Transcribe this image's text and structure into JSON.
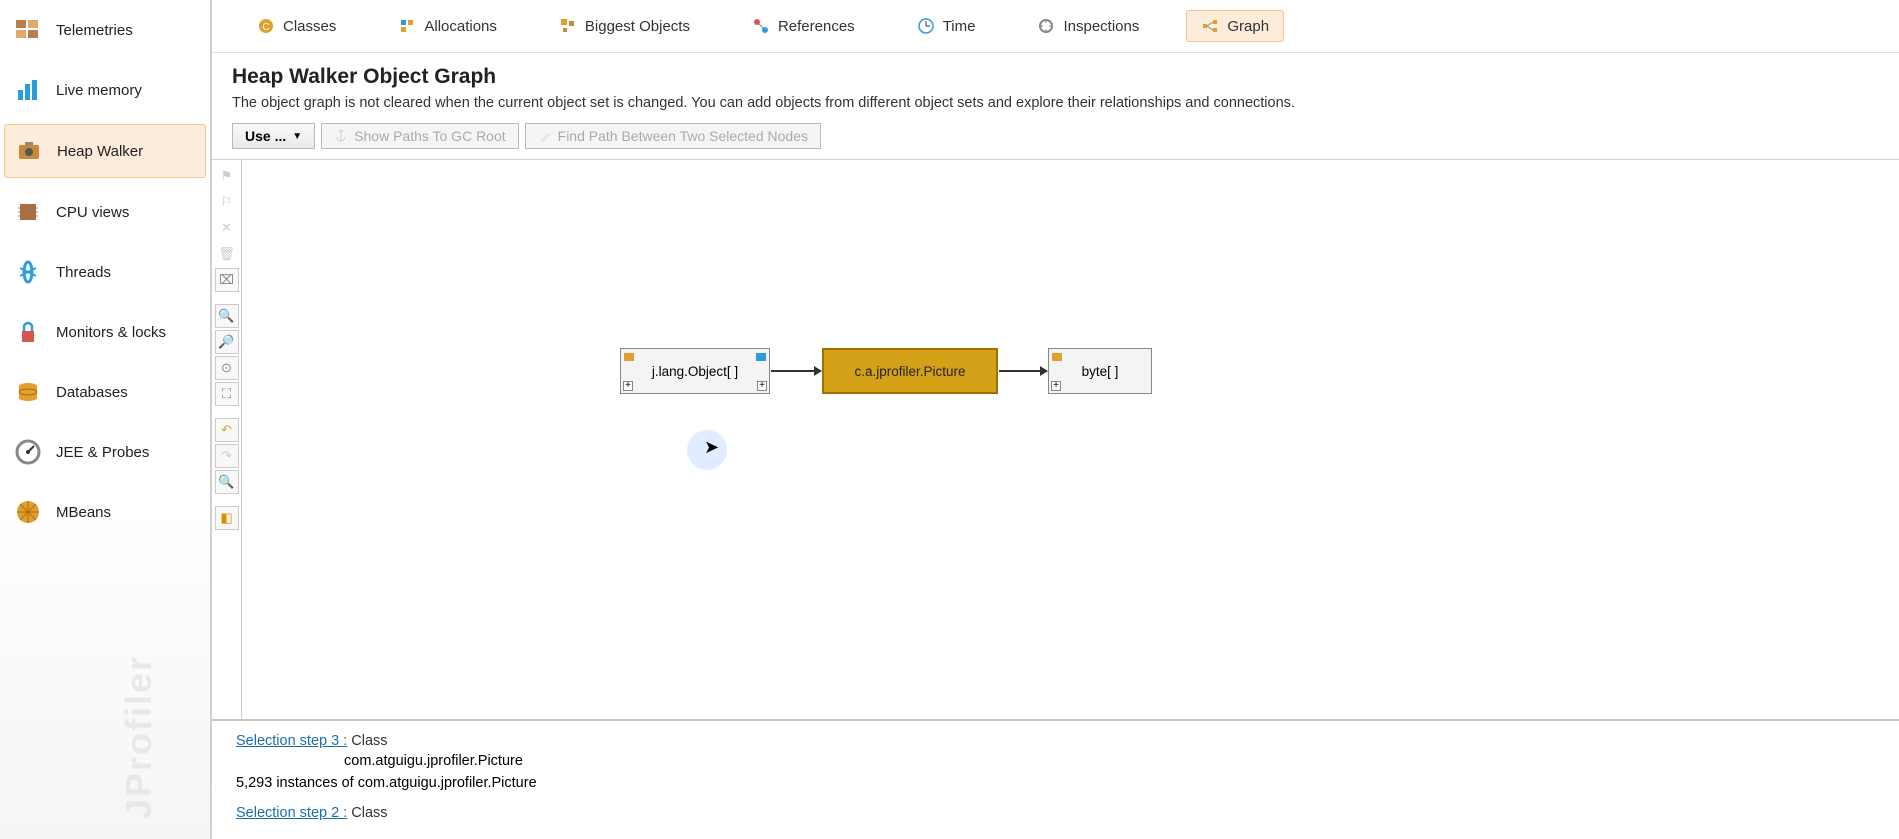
{
  "sidebar": {
    "items": [
      {
        "label": "Telemetries"
      },
      {
        "label": "Live memory"
      },
      {
        "label": "Heap Walker"
      },
      {
        "label": "CPU views"
      },
      {
        "label": "Threads"
      },
      {
        "label": "Monitors & locks"
      },
      {
        "label": "Databases"
      },
      {
        "label": "JEE & Probes"
      },
      {
        "label": "MBeans"
      }
    ],
    "watermark": "JProfiler"
  },
  "tabs": [
    {
      "label": "Classes"
    },
    {
      "label": "Allocations"
    },
    {
      "label": "Biggest Objects"
    },
    {
      "label": "References"
    },
    {
      "label": "Time"
    },
    {
      "label": "Inspections"
    },
    {
      "label": "Graph"
    }
  ],
  "header": {
    "title": "Heap Walker Object Graph",
    "desc": "The object graph is not cleared when the current object set is changed. You can add objects from different object sets and explore their relationships and connections."
  },
  "toolbar": {
    "use": "Use ...",
    "gcroot": "Show Paths To GC Root",
    "findpath": "Find Path Between Two Selected Nodes"
  },
  "graph": {
    "node1": "j.lang.Object[ ]",
    "node2": "c.a.jprofiler.Picture",
    "node3": "byte[ ]"
  },
  "bottom": {
    "step3_link": "Selection step 3 :",
    "step3_label": " Class",
    "step3_class": "com.atguigu.jprofiler.Picture",
    "step3_count": "5,293 instances of com.atguigu.jprofiler.Picture",
    "step2_link": "Selection step 2 :",
    "step2_label": " Class"
  }
}
